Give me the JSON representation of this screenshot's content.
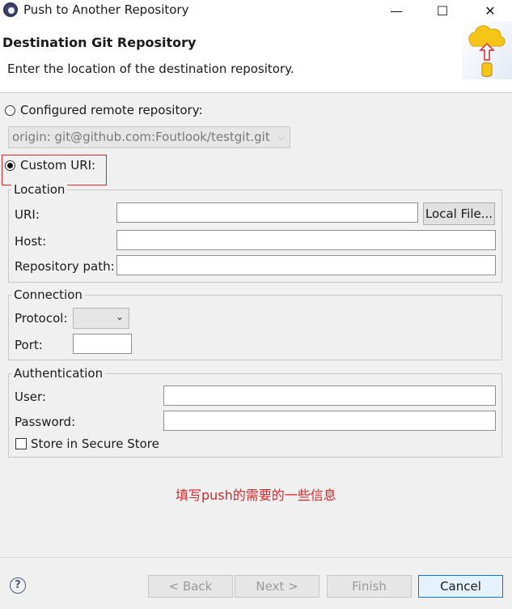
{
  "window": {
    "title": "Push to Another Repository",
    "minimize_glyph": "—",
    "maximize_glyph": "☐",
    "close_glyph": "✕"
  },
  "banner": {
    "title": "Destination Git Repository",
    "description": "Enter the location of the destination repository.",
    "image_icon": "cloud-upload-database-icon"
  },
  "source": {
    "configured_remote_label": "Configured remote repository:",
    "configured_remote_selected": false,
    "configured_remote_value": "origin: git@github.com:Foutlook/testgit.git",
    "custom_uri_label": "Custom URI:",
    "custom_uri_selected": true
  },
  "location": {
    "title": "Location",
    "uri_label": "URI:",
    "uri_value": "",
    "local_file_button": "Local File...",
    "host_label": "Host:",
    "host_value": "",
    "repo_path_label": "Repository path:",
    "repo_path_value": ""
  },
  "connection": {
    "title": "Connection",
    "protocol_label": "Protocol:",
    "protocol_value": "",
    "port_label": "Port:",
    "port_value": ""
  },
  "authentication": {
    "title": "Authentication",
    "user_label": "User:",
    "user_value": "",
    "password_label": "Password:",
    "password_value": "",
    "store_label": "Store in Secure Store",
    "store_checked": false
  },
  "annotation": {
    "text": "填写push的需要的一些信息",
    "color": "#d9262b"
  },
  "footer": {
    "help_glyph": "?",
    "back_button": "< Back",
    "next_button": "Next >",
    "finish_button": "Finish",
    "cancel_button": "Cancel"
  }
}
